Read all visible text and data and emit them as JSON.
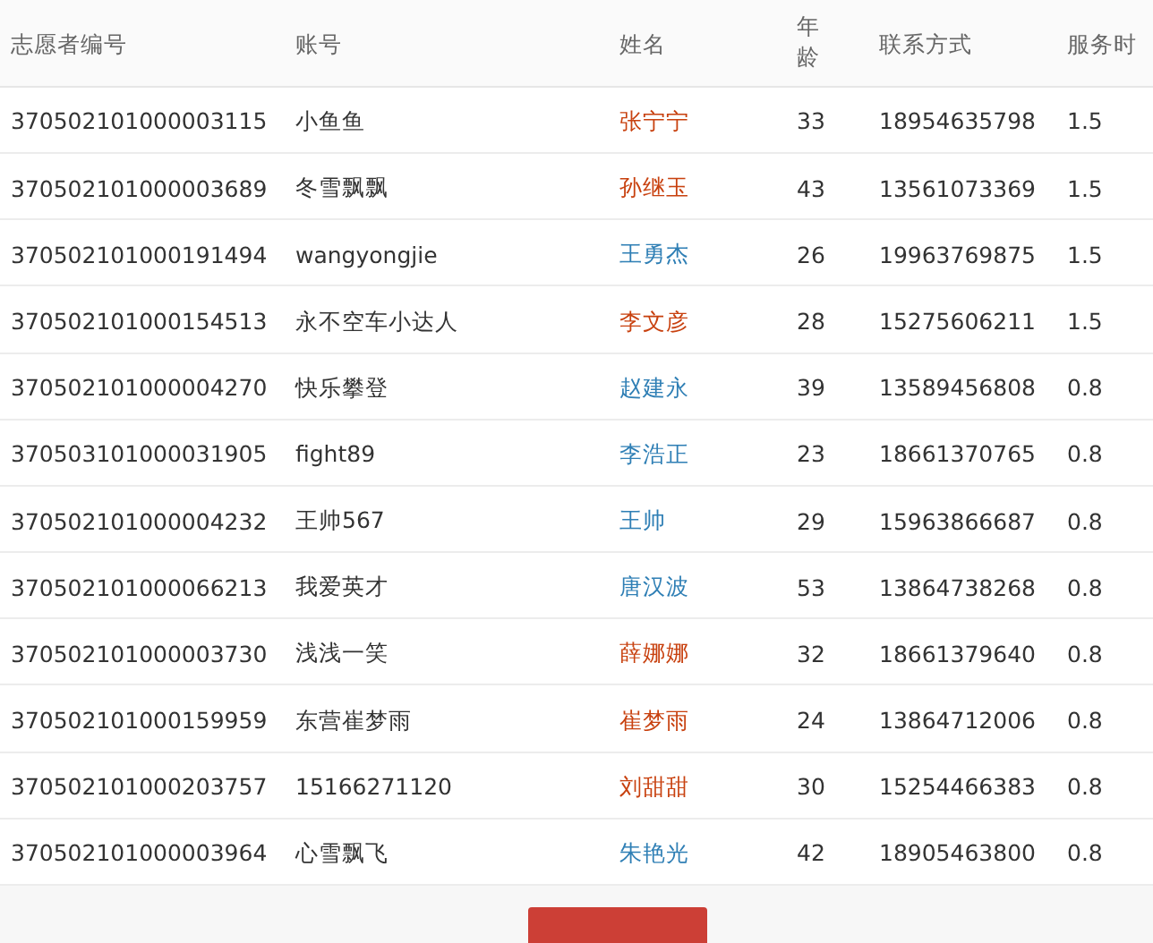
{
  "table": {
    "columns": [
      "志愿者编号",
      "账号",
      "姓名",
      "年龄",
      "联系方式",
      "服务时"
    ],
    "rows": [
      {
        "id": "370502101000003115",
        "account": "小鱼鱼",
        "name": "张宁宁",
        "color": "#c8410f",
        "age": "33",
        "phone": "18954635798",
        "hours": "1.5"
      },
      {
        "id": "370502101000003689",
        "account": "冬雪飘飘",
        "name": "孙继玉",
        "color": "#c8410f",
        "age": "43",
        "phone": "13561073369",
        "hours": "1.5"
      },
      {
        "id": "370502101000191494",
        "account": "wangyongjie",
        "name": "王勇杰",
        "color": "#2f7fb5",
        "age": "26",
        "phone": "19963769875",
        "hours": "1.5"
      },
      {
        "id": "370502101000154513",
        "account": "永不空车小达人",
        "name": "李文彦",
        "color": "#c8410f",
        "age": "28",
        "phone": "15275606211",
        "hours": "1.5"
      },
      {
        "id": "370502101000004270",
        "account": "快乐攀登",
        "name": "赵建永",
        "color": "#2f7fb5",
        "age": "39",
        "phone": "13589456808",
        "hours": "0.8"
      },
      {
        "id": "370503101000031905",
        "account": "fight89",
        "name": "李浩正",
        "color": "#2f7fb5",
        "age": "23",
        "phone": "18661370765",
        "hours": "0.8"
      },
      {
        "id": "370502101000004232",
        "account": "王帅567",
        "name": "王帅",
        "color": "#2f7fb5",
        "age": "29",
        "phone": "15963866687",
        "hours": "0.8"
      },
      {
        "id": "370502101000066213",
        "account": "我爱英才",
        "name": "唐汉波",
        "color": "#2f7fb5",
        "age": "53",
        "phone": "13864738268",
        "hours": "0.8"
      },
      {
        "id": "370502101000003730",
        "account": "浅浅一笑",
        "name": "薛娜娜",
        "color": "#c8410f",
        "age": "32",
        "phone": "18661379640",
        "hours": "0.8"
      },
      {
        "id": "370502101000159959",
        "account": "东营崔梦雨",
        "name": "崔梦雨",
        "color": "#c8410f",
        "age": "24",
        "phone": "13864712006",
        "hours": "0.8"
      },
      {
        "id": "370502101000203757",
        "account": "15166271120",
        "name": "刘甜甜",
        "color": "#c8410f",
        "age": "30",
        "phone": "15254466383",
        "hours": "0.8"
      },
      {
        "id": "370502101000003964",
        "account": "心雪飘飞",
        "name": "朱艳光",
        "color": "#2f7fb5",
        "age": "42",
        "phone": "18905463800",
        "hours": "0.8"
      }
    ]
  }
}
